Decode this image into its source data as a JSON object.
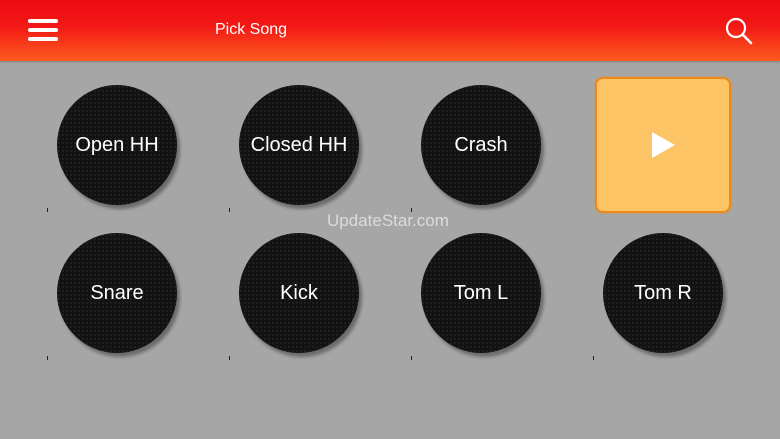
{
  "header": {
    "title": "Pick Song",
    "menu_icon": "hamburger-menu-icon",
    "search_icon": "search-icon"
  },
  "pads": [
    {
      "label": "Open HH"
    },
    {
      "label": "Closed HH"
    },
    {
      "label": "Crash"
    },
    {
      "label": "Snare"
    },
    {
      "label": "Kick"
    },
    {
      "label": "Tom L"
    },
    {
      "label": "Tom R"
    }
  ],
  "play_button": {
    "icon": "play-icon"
  },
  "watermark": "UpdateStar.com",
  "colors": {
    "header_top": "#ee0a14",
    "header_bottom": "#fb5a1e",
    "background": "#a6a6a6",
    "pad": "#121212",
    "play_fill": "#fdc465",
    "play_border": "#ee8a1a"
  }
}
